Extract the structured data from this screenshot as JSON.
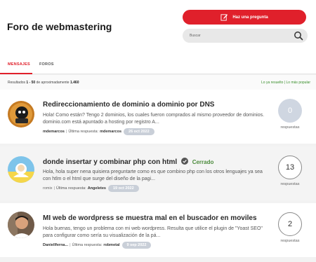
{
  "header": {
    "title": "Foro de webmastering",
    "ask_button_label": "Haz una pregunta",
    "search_placeholder": "Buscar"
  },
  "tabs": [
    {
      "label": "MENSAJES",
      "active": true
    },
    {
      "label": "FOROS",
      "active": false
    }
  ],
  "results": {
    "prefix": "Resultados",
    "range": "1 - 50",
    "middle": "de aproximadamente",
    "total": "1.460"
  },
  "filters": {
    "solved": "Lo ya resuelto",
    "separator": "|",
    "popular": "Lo más popular"
  },
  "threads": [
    {
      "title": "Redireccionamiento de dominio a dominio por DNS",
      "closed_label": "",
      "excerpt": "Hola! Como están? Tengo 2 dominios, los cuales fueron comprados al mismo proveedor de dominios. dominio.com está apuntado a hosting por registro A...",
      "author": "mdemarcos",
      "last_reply_label": "Última respuesta:",
      "last_reply_user": "mdemarcos",
      "date": "26 oct 2022",
      "reply_count": "0",
      "reply_label": "respuestas"
    },
    {
      "title": "donde insertar y combinar php con html",
      "closed_label": "Cerrado",
      "excerpt": "Hola, hola super nena quisiera preguntarte como es que combino php con los otros lenguajes ya sea con htlm o el html que surge del diseño de la pagi...",
      "author": "romix",
      "last_reply_label": "Última respuesta:",
      "last_reply_user": "Angeletes",
      "date": "19 oct 2022",
      "reply_count": "13",
      "reply_label": "respuestas"
    },
    {
      "title": "MI web de wordpress se muestra mal en el buscador en moviles",
      "closed_label": "",
      "excerpt": "Hola buenas, tengo un problema con mi web wordpress. Resulta que utilice el plugin de \"Yoast SEO\" para configurar como sería su visualización de la pá...",
      "author": "Daniellferna...",
      "last_reply_label": "Última respuesta:",
      "last_reply_user": "robmetal",
      "date": "9 sep 2022",
      "reply_count": "2",
      "reply_label": "respuestas"
    }
  ],
  "colors": {
    "accent": "#e0202b",
    "filter_green": "#3a8f2c",
    "date_badge": "#c9cfd8"
  },
  "icons": {
    "ask": "edit-icon",
    "search": "search-icon",
    "closed": "check-circle-icon"
  }
}
